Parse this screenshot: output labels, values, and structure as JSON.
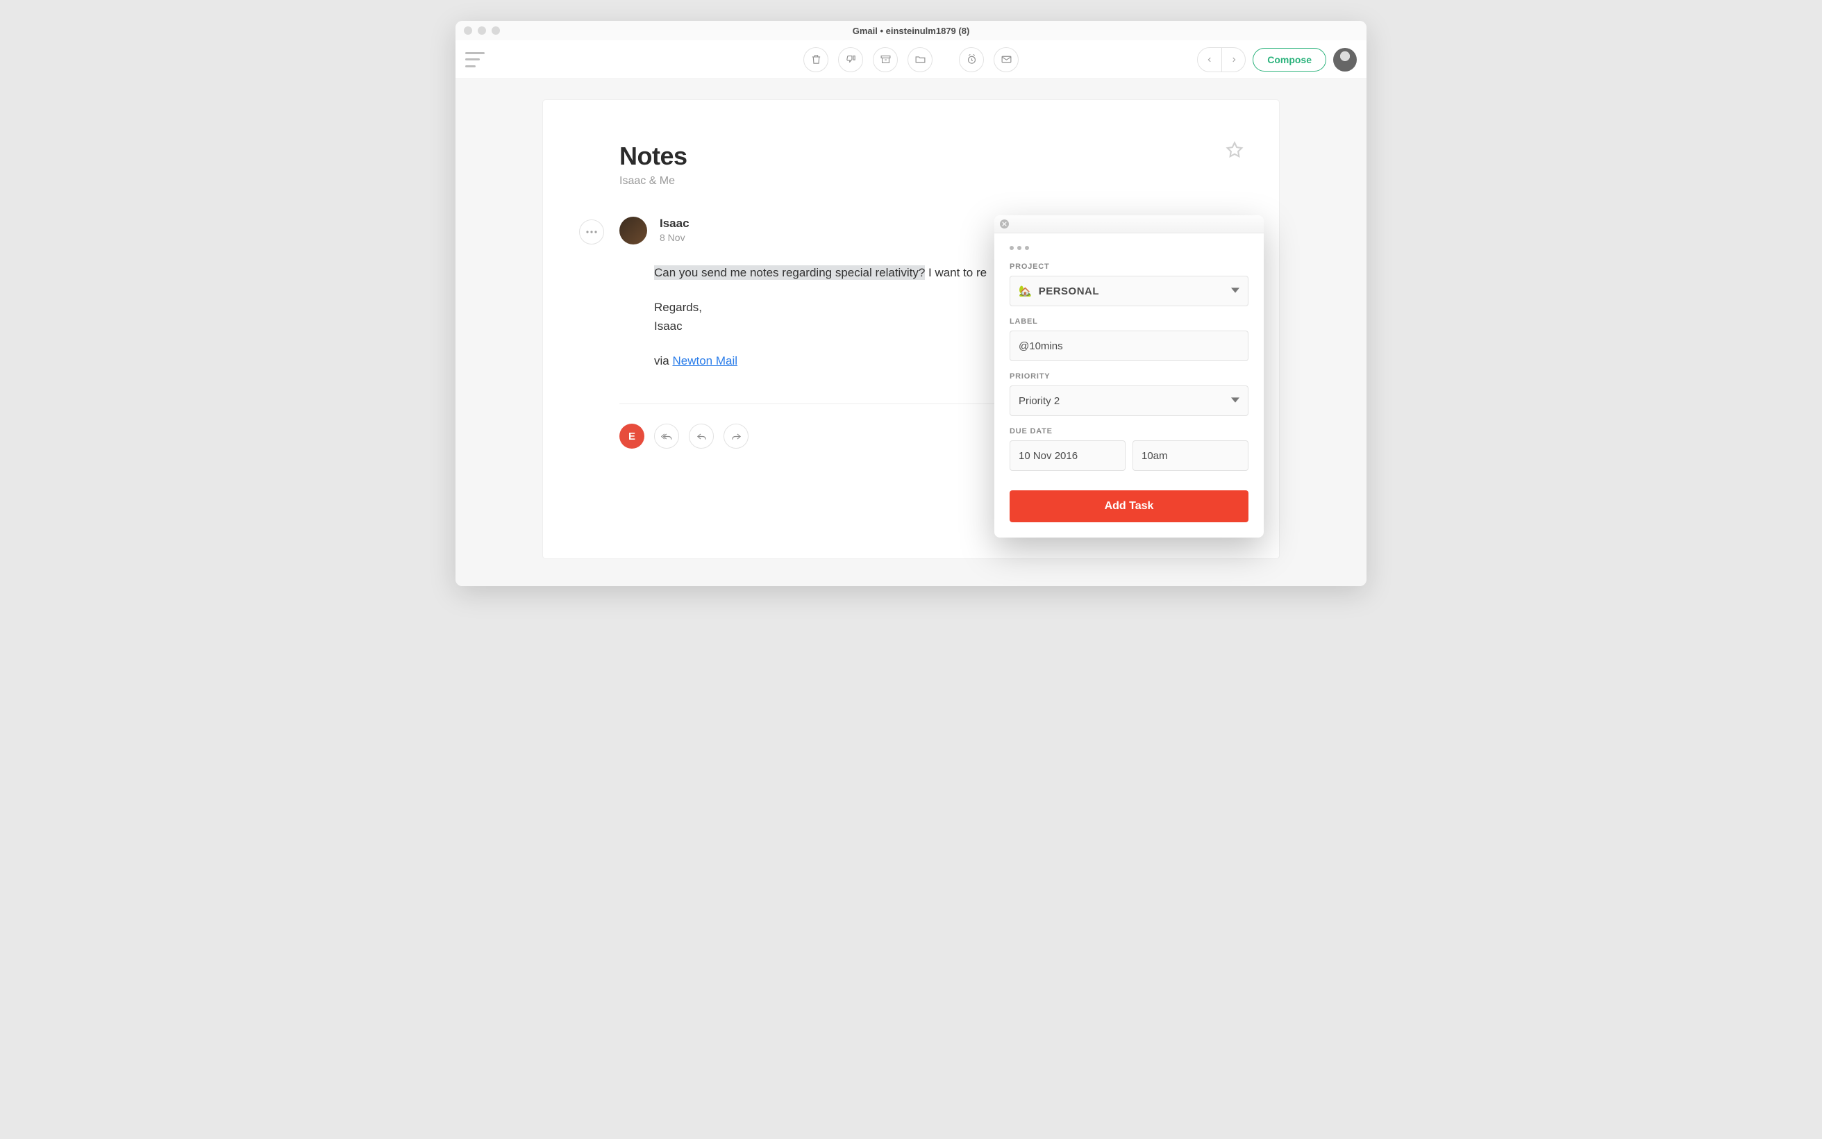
{
  "window": {
    "title": "Gmail • einsteinulm1879 (8)"
  },
  "toolbar": {
    "compose_label": "Compose"
  },
  "email": {
    "subject": "Notes",
    "participants": "Isaac & Me",
    "sender_name": "Isaac",
    "sender_date": "8 Nov",
    "body_highlighted": "Can you send me notes regarding special relativity?",
    "body_rest": " I want to re",
    "signoff": "Regards,",
    "sender_first": "Isaac",
    "via_prefix": "via ",
    "via_link_text": "Newton Mail",
    "reply_badge_letter": "E"
  },
  "task_popup": {
    "labels": {
      "project": "PROJECT",
      "label": "LABEL",
      "priority": "PRIORITY",
      "due_date": "DUE DATE"
    },
    "project_icon": "🏡",
    "project_value": "PERSONAL",
    "label_value": "@10mins",
    "priority_value": "Priority 2",
    "due_date_value": "10 Nov 2016",
    "due_time_value": "10am",
    "add_button": "Add Task"
  }
}
